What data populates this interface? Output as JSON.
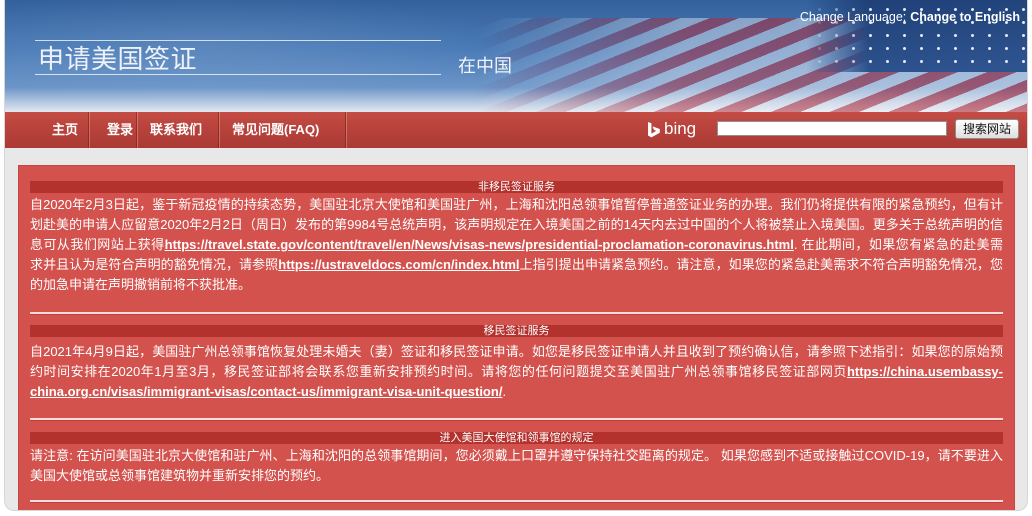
{
  "header": {
    "title": "申请美国签证",
    "subtitle": "在中国",
    "language_label": "Change Language:",
    "language_link": "Change to English"
  },
  "nav": {
    "items": [
      {
        "label": "主页"
      },
      {
        "label": "登录"
      },
      {
        "label": "联系我们"
      },
      {
        "label": "常见问题(FAQ)"
      }
    ]
  },
  "search": {
    "brand": "bing",
    "brand_icon": "bing-logo-icon",
    "value": "",
    "button_label": "搜索网站"
  },
  "notices": [
    {
      "title": "非移民签证服务",
      "paragraph": [
        {
          "text": "自2020年2月3日起，鉴于新冠疫情的持续态势，美国驻北京大使馆和美国驻广州，上海和沈阳总领事馆暂停普通签证业务的办理。我们仍将提供有限的紧急预约，但有计划赴美的申请人应留意2020年2月2日（周日）发布的第9984号总统声明，该声明规定在入境美国之前的14天内去过中国的个人将被禁止入境美国。更多关于总统声明的信息可从我们网站上获得"
        },
        {
          "link": "https://travel.state.gov/content/travel/en/News/visas-news/presidential-proclamation-coronavirus.html"
        },
        {
          "text": ". 在此期间，如果您有紧急的赴美需求并且认为是符合声明的豁免情况，请参照"
        },
        {
          "link": "https://ustraveldocs.com/cn/index.html"
        },
        {
          "text": "上指引提出申请紧急预约。请注意，如果您的紧急赴美需求不符合声明豁免情况，您的加急申请在声明撤销前将不获批准。"
        }
      ]
    },
    {
      "title": "移民签证服务",
      "paragraph": [
        {
          "text": "自2021年4月9日起，美国驻广州总领事馆恢复处理未婚夫（妻）签证和移民签证申请。如您是移民签证申请人并且收到了预约确认信，请参照下述指引：如果您的原始预约时间安排在2020年1月至3月，移民签证部将会联系您重新安排预约时间。请将您的任何问题提交至美国驻广州总领事馆移民签证部网页"
        },
        {
          "link": "https://china.usembassy-china.org.cn/visas/immigrant-visas/contact-us/immigrant-visa-unit-question/"
        },
        {
          "text": "."
        }
      ]
    },
    {
      "title": "进入美国大使馆和领事馆的规定",
      "paragraph": [
        {
          "text": "请注意: 在访问美国驻北京大使馆和驻广州、上海和沈阳的总领事馆期间，您必须戴上口罩并遵守保持社交距离的规定。 如果您感到不适或接触过COVID-19，请不要进入美国大使馆或总领事馆建筑物并重新安排您的预约。"
        }
      ]
    }
  ],
  "colors": {
    "header_blue": "#4a7bb7",
    "nav_red": "#b8433c",
    "panel_red": "#d4524d",
    "bar_red": "#b3322e",
    "page_bg": "#e8e8e8"
  }
}
